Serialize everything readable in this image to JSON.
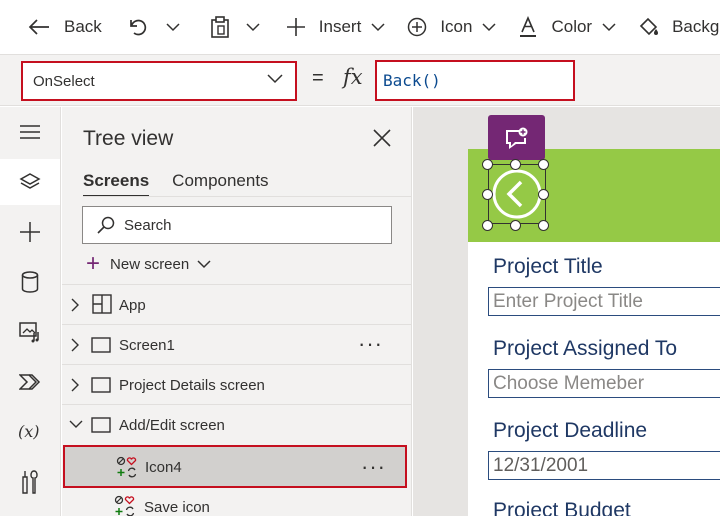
{
  "toolbar": {
    "back_label": "Back",
    "insert_label": "Insert",
    "icon_label": "Icon",
    "color_label": "Color",
    "background_label": "Background"
  },
  "formula_bar": {
    "property": "OnSelect",
    "equals": "=",
    "fx": "fx",
    "formula": "Back()"
  },
  "tree_view": {
    "title": "Tree view",
    "tabs": [
      {
        "label": "Screens",
        "active": true
      },
      {
        "label": "Components",
        "active": false
      }
    ],
    "search_placeholder": "Search",
    "new_screen_label": "New screen",
    "items": [
      {
        "label": "App",
        "icon": "app-grid-icon"
      },
      {
        "label": "Screen1",
        "icon": "screen-icon",
        "more": "···"
      },
      {
        "label": "Project Details screen",
        "icon": "screen-icon"
      },
      {
        "label": "Add/Edit screen",
        "icon": "screen-icon"
      },
      {
        "label": "Icon4",
        "icon": "shapes-icon",
        "more": "···",
        "selected": true
      },
      {
        "label": "Save icon",
        "icon": "shapes-icon"
      }
    ]
  },
  "canvas": {
    "header_color": "#95c946",
    "fields": [
      {
        "label": "Project Title",
        "placeholder": "Enter Project Title"
      },
      {
        "label": "Project Assigned To",
        "placeholder": "Choose Memeber"
      },
      {
        "label": "Project Deadline",
        "value": "12/31/2001"
      },
      {
        "label": "Project Budget"
      }
    ]
  },
  "colors": {
    "accent_purple": "#742774",
    "highlight_red": "#c50f1f",
    "field_label": "#1f3864"
  }
}
